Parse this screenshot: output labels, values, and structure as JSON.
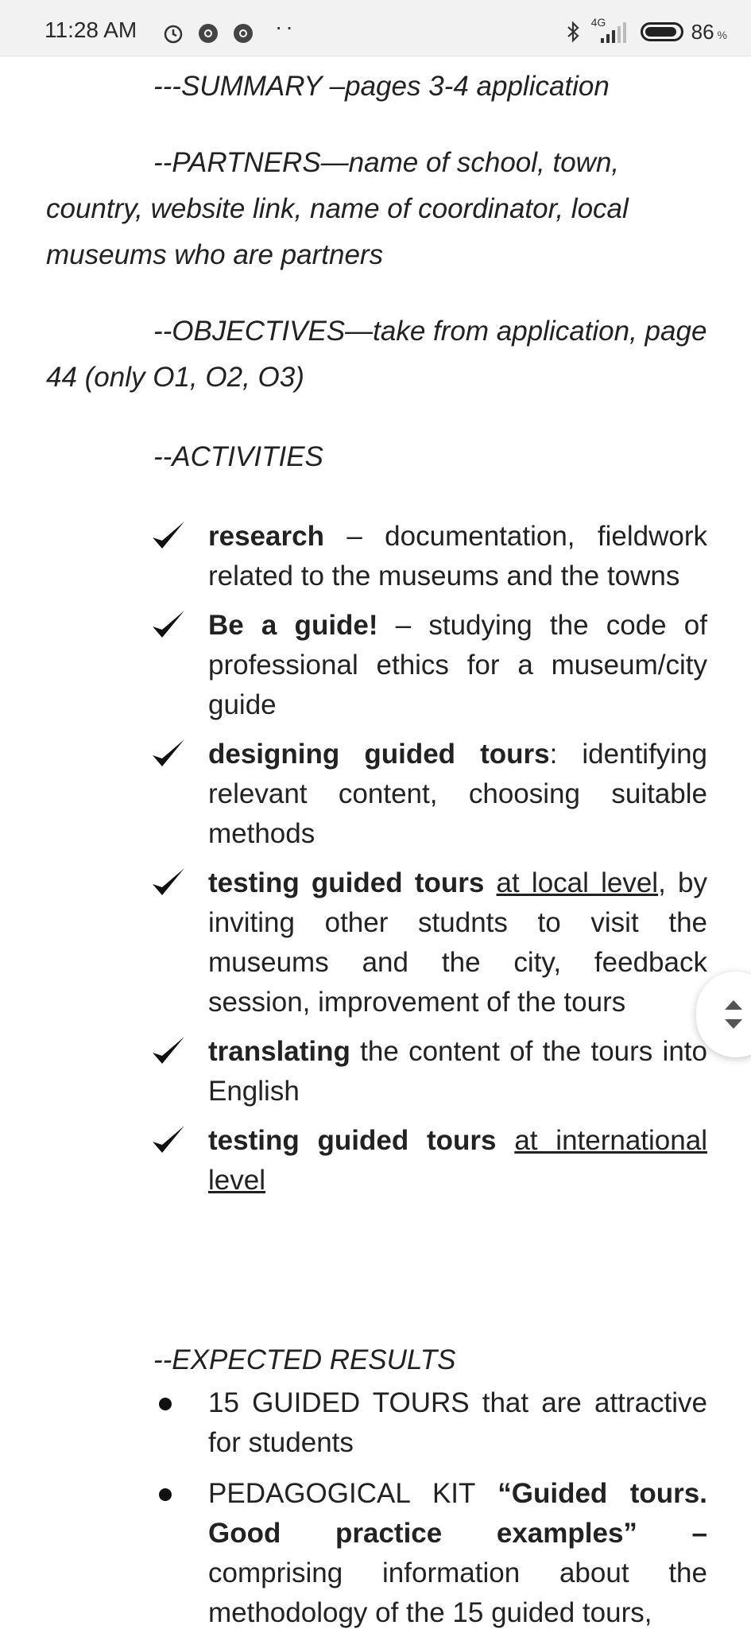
{
  "status_bar": {
    "time": "11:28 AM",
    "network": "4G",
    "battery": "86",
    "battery_unit": "%"
  },
  "document": {
    "summary": "---SUMMARY –pages 3-4 application",
    "partners_first": "--PARTNERS—name of school, town,",
    "partners_rest": "country, website link, name of coordinator, local museums who are partners",
    "objectives_first": "--OBJECTIVES—take from application,",
    "objectives_rest": "page 44 (only O1, O2, O3)",
    "activities_heading": "--ACTIVITIES",
    "activities": [
      {
        "bold": "research",
        "text": " – documentation, fieldwork related to the museums and the towns",
        "ul": "",
        "text2": ""
      },
      {
        "bold": "Be a guide!",
        "text": " – studying the code of professional ethics for a museum/city guide",
        "ul": "",
        "text2": ""
      },
      {
        "bold": "designing guided tours",
        "text": ": identifying relevant content, choosing suitable methods",
        "ul": "",
        "text2": ""
      },
      {
        "bold": "testing guided tours",
        "text": " ",
        "ul": "at local level",
        "text2": ", by inviting other studnts to visit the museums and the city, feedback session, improvement of the tours"
      },
      {
        "bold": "translating",
        "text": " the content of the tours into English",
        "ul": "",
        "text2": ""
      },
      {
        "bold": "testing guided tours",
        "text": " ",
        "ul": "at international level",
        "text2": ""
      }
    ],
    "results_heading": "--EXPECTED RESULTS",
    "results": [
      {
        "pre": "15 GUIDED TOURS that are attractive for students",
        "bold": "",
        "post": ""
      },
      {
        "pre": "PEDAGOGICAL KIT ",
        "bold": "“Guided tours. Good practice examples” –",
        "post": " comprising information about the methodology of the 15 guided tours,"
      }
    ]
  }
}
